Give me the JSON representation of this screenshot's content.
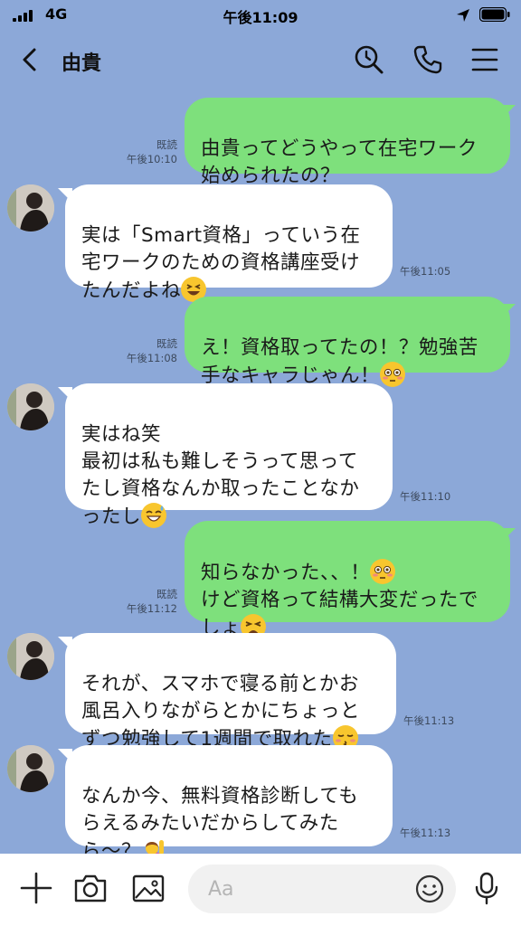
{
  "status_bar": {
    "carrier": "4G",
    "time": "午後11:09"
  },
  "header": {
    "title": "由貴"
  },
  "messages": [
    {
      "dir": "out",
      "text": "由貴ってどうやって在宅ワーク\n始められたの？",
      "read": "既読",
      "time": "午後10:10"
    },
    {
      "dir": "in",
      "text": "実は「Smart資格」っていう在\n宅ワークのための資格講座受け\nたんだよね",
      "emoji": "grinning-squint",
      "time": "午後11:05"
    },
    {
      "dir": "out",
      "text": "え！資格取ってたの！？勉強苦\n手なキャラじゃん！",
      "emoji": "flushed",
      "read": "既読",
      "time": "午後11:08"
    },
    {
      "dir": "in",
      "text": "実はね笑\n最初は私も難しそうって思って\nたし資格なんか取ったことなか\nったし",
      "emoji": "sweat-smile",
      "time": "午後11:10"
    },
    {
      "dir": "out",
      "text": "知らなかった、、！",
      "emoji": "flushed",
      "text2": "\nけど資格って結構大変だったで\nしょ",
      "emoji2": "tired",
      "read": "既読",
      "time": "午後11:12"
    },
    {
      "dir": "in",
      "text": "それが、スマホで寝る前とかお\n風呂入りながらとかにちょっと\nずつ勉強して1週間で取れた",
      "emoji": "kissing",
      "time": "午後11:13"
    },
    {
      "dir": "in",
      "text": "なんか今、無料資格診断しても\nらえるみたいだからしてみた\nら〜？",
      "emoji": "raising-hand",
      "time": "午後11:13"
    }
  ],
  "input": {
    "placeholder": "Aa"
  },
  "icons": {
    "back": "back-icon",
    "search": "search-icon",
    "phone": "phone-icon",
    "menu": "menu-icon",
    "plus": "plus-icon",
    "camera": "camera-icon",
    "image": "image-icon",
    "smiley": "smiley-icon",
    "mic": "mic-icon"
  },
  "colors": {
    "background": "#8ca8d8",
    "outgoing_bubble": "#7ee07c",
    "incoming_bubble": "#ffffff"
  }
}
